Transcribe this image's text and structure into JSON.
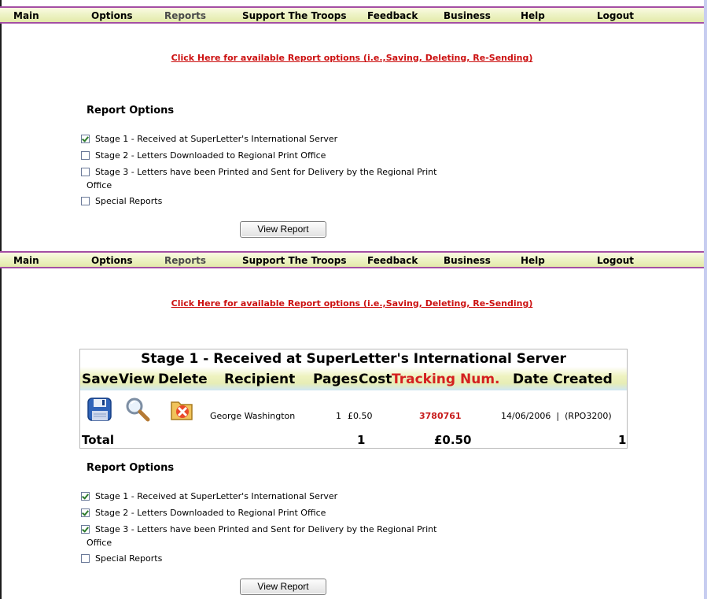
{
  "nav": {
    "items": [
      "Main",
      "Options",
      "Reports",
      "Support The Troops",
      "Feedback",
      "Business",
      "Help",
      "Logout"
    ]
  },
  "report_link": "Click Here for available Report options (i.e.,Saving, Deleting, Re-Sending)",
  "section1": {
    "title": "Report Options",
    "options": [
      {
        "label": "Stage 1 - Received at SuperLetter's International Server",
        "checked": true
      },
      {
        "label": "Stage 2 - Letters Downloaded to Regional Print Office",
        "checked": false
      },
      {
        "label": "Stage 3 - Letters have been Printed and Sent for Delivery by the Regional Print",
        "wrap": "Office",
        "checked": false
      },
      {
        "label": "Special Reports",
        "checked": false
      }
    ],
    "button": "View Report"
  },
  "report": {
    "title": "Stage 1 - Received at SuperLetter's International Server",
    "headers": [
      "Save",
      "View",
      "Delete",
      "Recipient",
      "Pages",
      "Cost",
      "Tracking Num.",
      "Date Created"
    ],
    "row": {
      "recipient": "George Washington",
      "pages": "1",
      "cost": "£0.50",
      "tracking": "3780761",
      "date": "14/06/2006  |  (RPO3200)"
    },
    "totals": {
      "label": "Total",
      "pages": "1",
      "cost": "£0.50",
      "count": "1"
    }
  },
  "section2": {
    "title": "Report Options",
    "options": [
      {
        "label": "Stage 1 - Received at SuperLetter's International Server",
        "checked": true
      },
      {
        "label": "Stage 2 - Letters Downloaded to Regional Print Office",
        "checked": true
      },
      {
        "label": "Stage 3 - Letters have been Printed and Sent for Delivery by the Regional Print",
        "wrap": "Office",
        "checked": true
      },
      {
        "label": "Special Reports",
        "checked": false
      }
    ],
    "button": "View Report"
  },
  "colors": {
    "nav_border": "#a44fa4",
    "link_red": "#cc1111",
    "tracking_red": "#d42020"
  }
}
